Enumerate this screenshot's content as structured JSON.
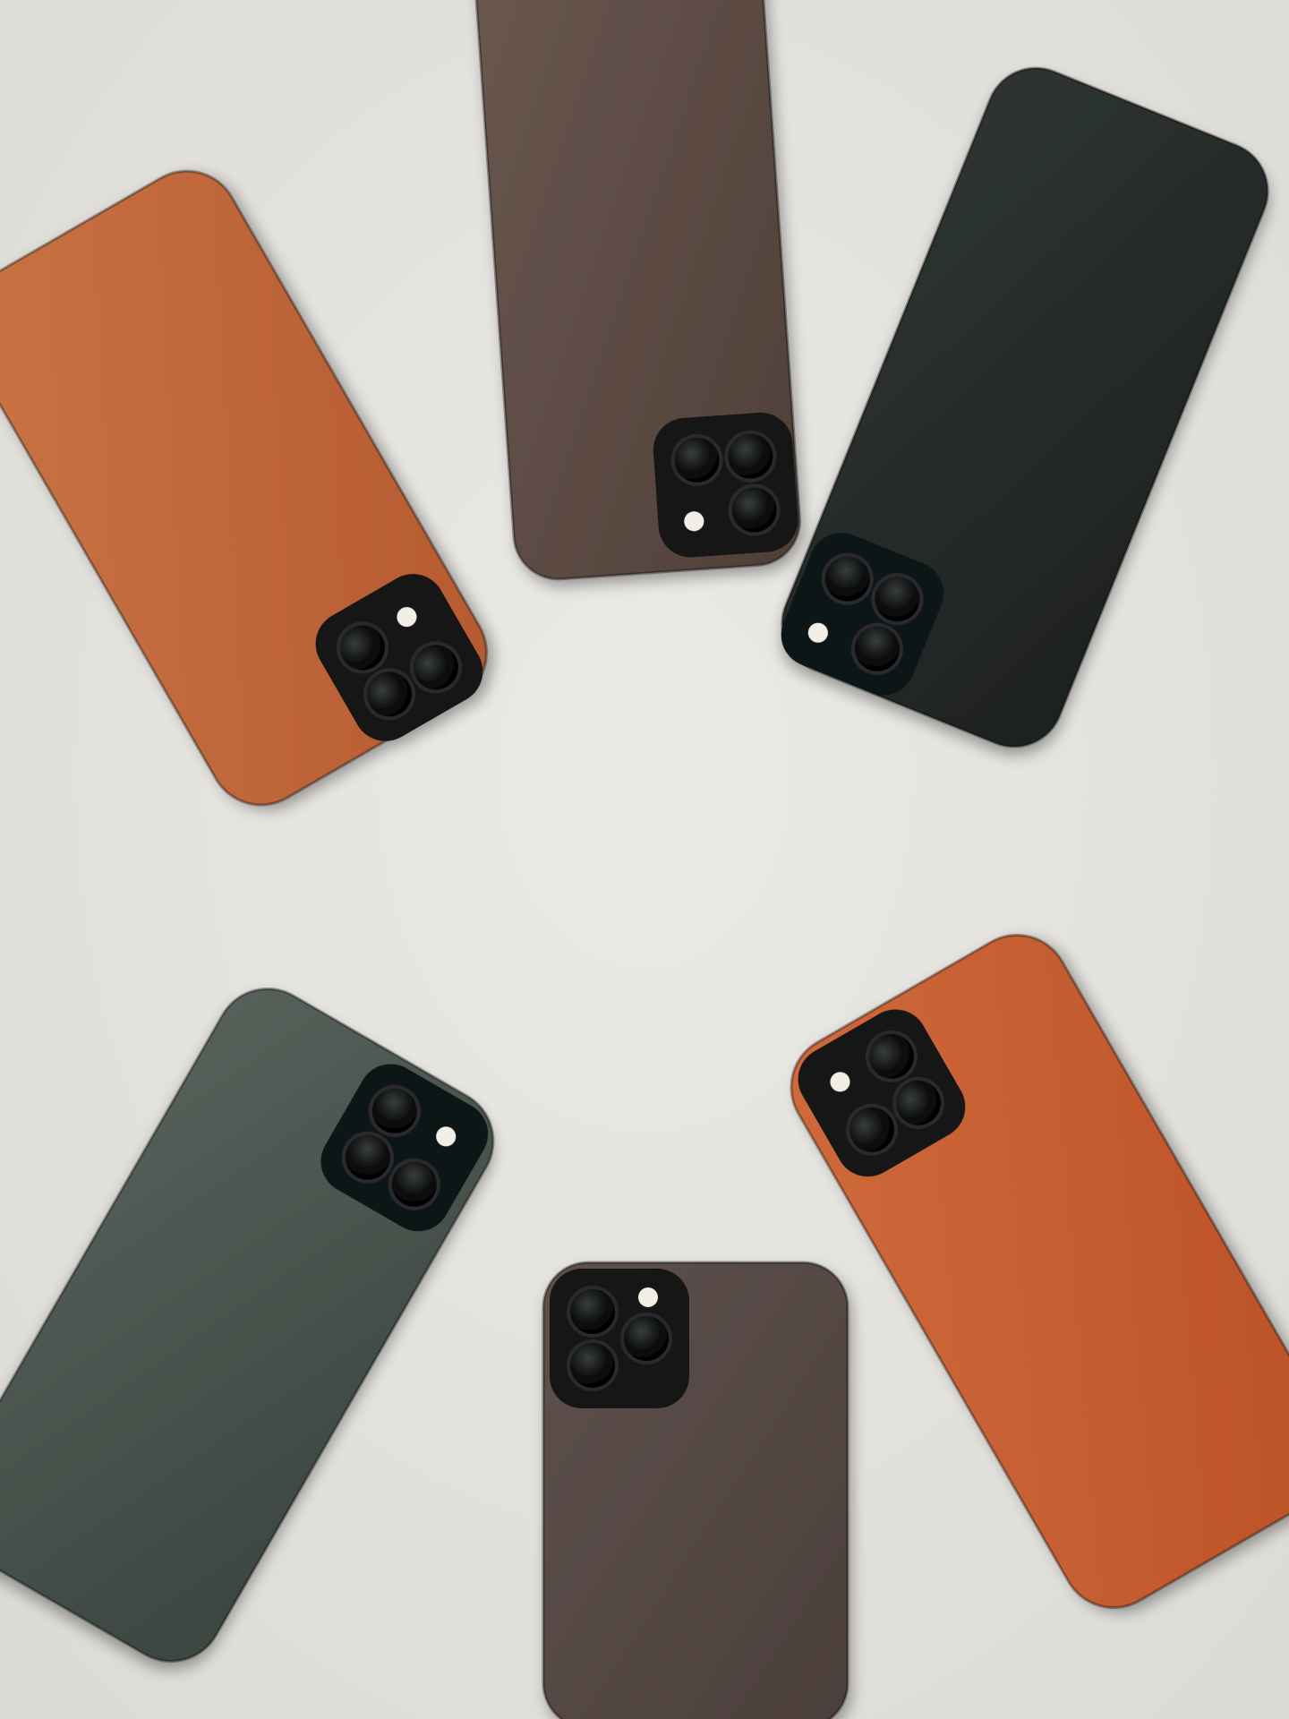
{
  "scene": {
    "background_color": "#e6e5e1",
    "subject": "leather-phone-cases",
    "phones": [
      {
        "id": "orange-top-left",
        "color": "#b65a30",
        "color_light": "#c97446",
        "camera_corner": "bottom-right"
      },
      {
        "id": "brown-top-center",
        "color": "#4f3f38",
        "color_light": "#6b5851",
        "camera_corner": "bottom-right"
      },
      {
        "id": "black-top-right",
        "color": "#1d2120",
        "color_light": "#2f3432",
        "camera_corner": "bottom-right"
      },
      {
        "id": "green-bottom-left",
        "color": "#3b4540",
        "color_light": "#56615b",
        "camera_corner": "top-right"
      },
      {
        "id": "brown-bottom-center",
        "color": "#4b3f3b",
        "color_light": "#5e514d",
        "camera_corner": "top-left"
      },
      {
        "id": "orange-bottom-right",
        "color": "#bb5127",
        "color_light": "#cf6a3b",
        "camera_corner": "top-left"
      }
    ]
  }
}
